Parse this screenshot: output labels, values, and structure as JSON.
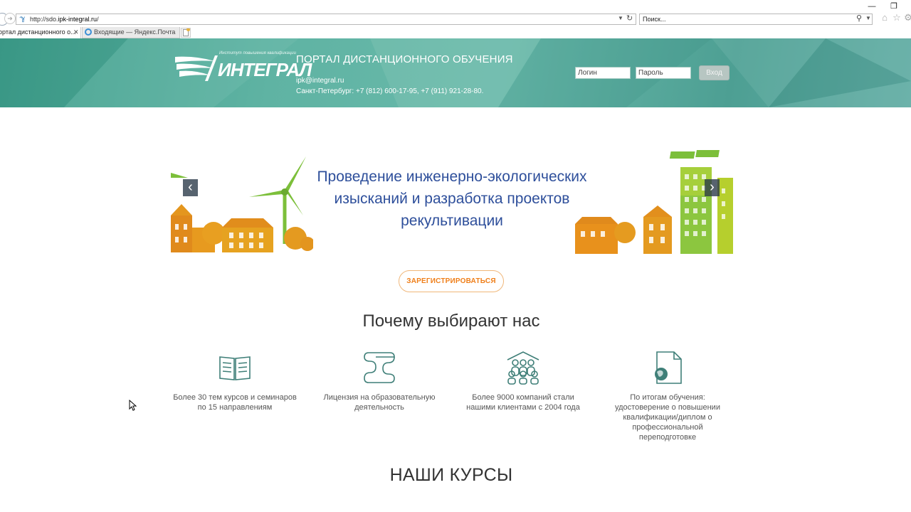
{
  "browser": {
    "url_prefix": "http://sdo.",
    "url_domain": "ipk-integral.ru",
    "url_suffix": "/",
    "search_placeholder": "Поиск...",
    "tabs": [
      {
        "label": "ортал дистанционного о...",
        "close": "✕"
      },
      {
        "label": "Входящие — Яндекс.Почта"
      }
    ],
    "window_controls": {
      "minimize": "—",
      "restore": "❐"
    }
  },
  "header": {
    "logo_tagline": "Институт повышения квалификации",
    "logo_name": "ИНТЕГРАЛ",
    "portal_title": "ПОРТАЛ ДИСТАНЦИОННОГО ОБУЧЕНИЯ",
    "email": "ipk@integral.ru",
    "phones": "Санкт-Петербург: +7 (812) 600-17-95, +7 (911) 921-28-80.",
    "login_value": "Логин",
    "password_value": "Пароль",
    "login_button": "Вход"
  },
  "banner": {
    "text": "Проведение инженерно-экологических изысканий и разработка проектов рекультивации",
    "prev": "‹",
    "next": "›"
  },
  "register_button": "ЗАРЕГИСТРИРОВАТЬСЯ",
  "why": {
    "title": "Почему выбирают нас",
    "features": [
      {
        "icon": "book-icon",
        "text": "Более 30 тем курсов и семинаров по 15 направлениям"
      },
      {
        "icon": "license-scroll-icon",
        "text": "Лицензия на образовательную деятельность"
      },
      {
        "icon": "people-icon",
        "text": "Более 9000 компаний стали нашими клиентами с 2004 года"
      },
      {
        "icon": "certificate-document-icon",
        "text": "По итогам обучения: удостоверение о повышении квалификации/диплом о профессиональной переподготовке"
      }
    ]
  },
  "courses": {
    "title": "НАШИ КУРСЫ"
  },
  "colors": {
    "header_teal": "#5fb3a3",
    "banner_text": "#2e4f9b",
    "accent_orange": "#ef7f1a",
    "icon_teal": "#3f7f78",
    "green_building": "#7cbf3a"
  }
}
